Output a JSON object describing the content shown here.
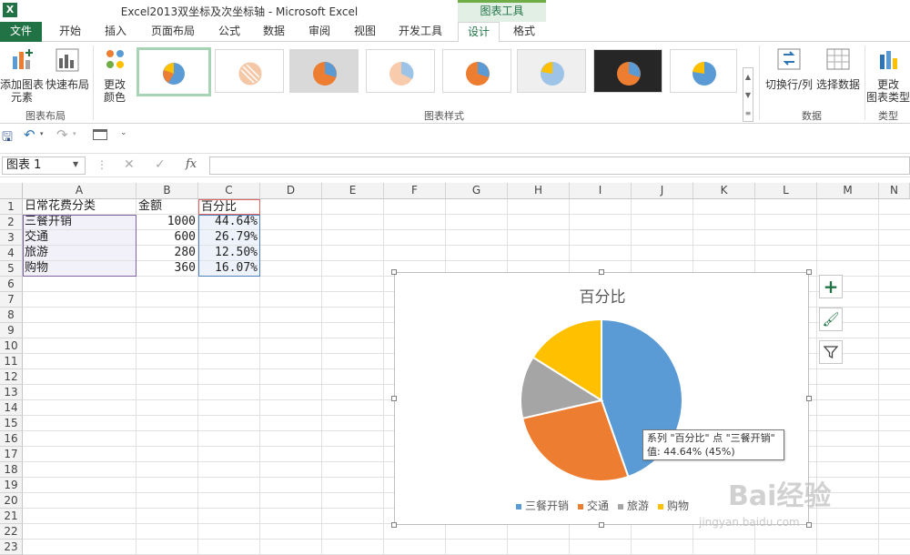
{
  "window": {
    "title": "Excel2013双坐标及次坐标轴 - Microsoft Excel",
    "context_tab_group": "图表工具"
  },
  "tabs": [
    {
      "label": "文件"
    },
    {
      "label": "开始"
    },
    {
      "label": "插入"
    },
    {
      "label": "页面布局"
    },
    {
      "label": "公式"
    },
    {
      "label": "数据"
    },
    {
      "label": "审阅"
    },
    {
      "label": "视图"
    },
    {
      "label": "开发工具"
    },
    {
      "label": "设计"
    },
    {
      "label": "格式"
    }
  ],
  "ribbon": {
    "add_element_1": "添加图表",
    "add_element_2": "元素",
    "quick_layout": "快速布局",
    "change_color_1": "更改",
    "change_color_2": "颜色",
    "group_layout": "图表布局",
    "group_styles": "图表样式",
    "switch_rowcol": "切换行/列",
    "select_data": "选择数据",
    "group_data": "数据",
    "change_type_1": "更改",
    "change_type_2": "图表类型",
    "group_type": "类型"
  },
  "formula_bar": {
    "name_box": "图表 1",
    "fx": "fx",
    "value": ""
  },
  "columns": [
    "A",
    "B",
    "C",
    "D",
    "E",
    "F",
    "G",
    "H",
    "I",
    "J",
    "K",
    "L",
    "M",
    "N"
  ],
  "rows": [
    "1",
    "2",
    "3",
    "4",
    "5",
    "6",
    "7",
    "8",
    "9",
    "10",
    "11",
    "12",
    "13",
    "14",
    "15",
    "16",
    "17",
    "18",
    "19",
    "20",
    "21",
    "22",
    "23"
  ],
  "sheet": {
    "header": [
      "日常花费分类",
      "金额",
      "百分比"
    ],
    "data": [
      [
        "三餐开销",
        "1000",
        "44.64%"
      ],
      [
        "交通",
        "600",
        "26.79%"
      ],
      [
        "旅游",
        "280",
        "12.50%"
      ],
      [
        "购物",
        "360",
        "16.07%"
      ]
    ]
  },
  "chart_data": {
    "type": "pie",
    "title": "百分比",
    "categories": [
      "三餐开销",
      "交通",
      "旅游",
      "购物"
    ],
    "values": [
      44.64,
      26.79,
      12.5,
      16.07
    ],
    "colors": [
      "#5b9bd5",
      "#ed7d31",
      "#a5a5a5",
      "#ffc000"
    ],
    "legend": "bottom"
  },
  "tooltip": {
    "line1": "系列 \"百分比\" 点 \"三餐开销\"",
    "line2": "值: 44.64% (45%)"
  },
  "watermark": {
    "brand": "Bai经验",
    "url": "jingyan.baidu.com"
  }
}
